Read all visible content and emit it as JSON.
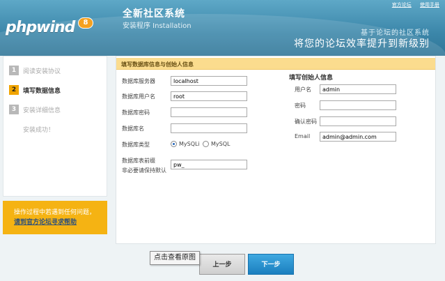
{
  "header": {
    "logo_text": "phpwind",
    "logo_version": "8",
    "title": "全新社区系统",
    "subtitle": "安装程序 Installation",
    "links": [
      "官方论坛",
      "使用手册"
    ],
    "slogan_line1": "基于论坛的社区系统",
    "slogan_line2": "将您的论坛效率提升到新级别"
  },
  "steps": [
    {
      "number": "1",
      "label": "阅读安装协议"
    },
    {
      "number": "2",
      "label": "填写数据信息"
    },
    {
      "number": "3",
      "label": "安装详细信息"
    },
    {
      "number": "",
      "label": "安装成功！"
    }
  ],
  "help": {
    "line1": "操作过程中若遇到任何问题，",
    "line2": "请到官方论坛寻求帮助"
  },
  "form": {
    "panel_title": "填写数据库信息与创始人信息",
    "db_server_label": "数据库服务器",
    "db_server_value": "localhost",
    "db_user_label": "数据库用户名",
    "db_user_value": "root",
    "db_password_label": "数据库密码",
    "db_password_value": "",
    "db_name_label": "数据库名",
    "db_name_value": "",
    "db_type_label": "数据库类型",
    "db_type_options": [
      "MySQLi",
      "MySQL"
    ],
    "db_type_selected": "MySQLi",
    "prefix_label_line1": "数据库表前缀",
    "prefix_label_line2": "非必要请保持默认",
    "prefix_value": "pw_",
    "admin_title": "填写创始人信息",
    "admin_user_label": "用户名",
    "admin_user_value": "admin",
    "admin_password_label": "密码",
    "admin_password_value": "",
    "admin_confirm_label": "确认密码",
    "admin_confirm_value": "",
    "admin_email_label": "Email",
    "admin_email_value": "admin@admin.com"
  },
  "buttons": {
    "prev": "上一步",
    "next": "下一步"
  },
  "tooltip": "点击查看原图",
  "colors": {
    "header_blue": "#3b86a9",
    "accent_orange": "#f0a400",
    "panel_title_bg": "#fbdc8e",
    "next_button": "#1b7fbf"
  }
}
